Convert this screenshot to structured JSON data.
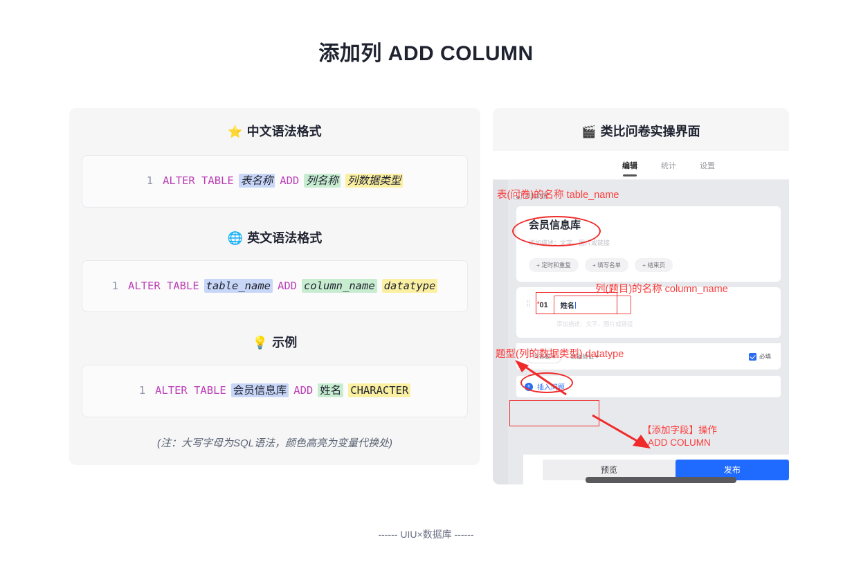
{
  "page": {
    "title": "添加列 ADD COLUMN",
    "footer": "------ UIU×数据库 ------"
  },
  "left_panel": {
    "heading": "中文语法格式",
    "heading_icon": "star-icon",
    "heading_icon_glyph": "⭐",
    "sections": [
      {
        "heading": "中文语法格式",
        "icon_glyph": "⭐",
        "line_number": "1",
        "tokens": {
          "kw1": "ALTER TABLE",
          "table": "表名称",
          "kw2": "ADD",
          "column": "列名称",
          "datatype": "列数据类型"
        }
      },
      {
        "heading": "英文语法格式",
        "icon_glyph": "🌐",
        "line_number": "1",
        "tokens": {
          "kw1": "ALTER TABLE",
          "table": "table_name",
          "kw2": "ADD",
          "column": "column_name",
          "datatype": "datatype"
        }
      },
      {
        "heading": "示例",
        "icon_glyph": "💡",
        "line_number": "1",
        "tokens": {
          "kw1": "ALTER TABLE",
          "table": "会员信息库",
          "kw2": "ADD",
          "column": "姓名",
          "datatype": "CHARACTER"
        }
      }
    ],
    "note": "(注：大写字母为SQL语法，颜色高亮为变量代换处)"
  },
  "right_panel": {
    "heading": "类比问卷实操界面",
    "heading_icon": "clapperboard-icon",
    "heading_icon_glyph": "🎬",
    "screenshot": {
      "tabs": [
        {
          "label": "编辑",
          "active": true
        },
        {
          "label": "统计",
          "active": false
        },
        {
          "label": "设置",
          "active": false
        }
      ],
      "cover_button": "添加封面",
      "form_title": "会员信息库",
      "form_desc": "添加描述：文字、图片或链接",
      "chips": [
        "+ 定时和重复",
        "+ 填写名单",
        "+ 结束页"
      ],
      "question": {
        "index": "01",
        "required_mark": "*",
        "value": "姓名",
        "desc": "添加描述：文字、图片或链接"
      },
      "options": {
        "type_select": "问答题 ▾",
        "validate_select": "数据验证 ▾",
        "required_label": "必填"
      },
      "insert_button": "插入问题",
      "insert_icon": "plus-circle-icon",
      "footer_buttons": {
        "preview": "预览",
        "publish": "发布"
      }
    },
    "annotations": {
      "table_name": "表(问卷)的名称 table_name",
      "column_name": "列(题目)的名称 column_name",
      "datatype": "题型(列的数据类型) datatype",
      "add_column_cn": "【添加字段】操作",
      "add_column_en": "ADD COLUMN"
    }
  },
  "colors": {
    "keyword": "#bb3fb5",
    "highlight_table": "#c8d7f7",
    "highlight_column": "#c7ecd0",
    "highlight_datatype": "#fbf0a2",
    "annotation_red": "#fb3b3b",
    "publish_blue": "#1f6bff"
  }
}
